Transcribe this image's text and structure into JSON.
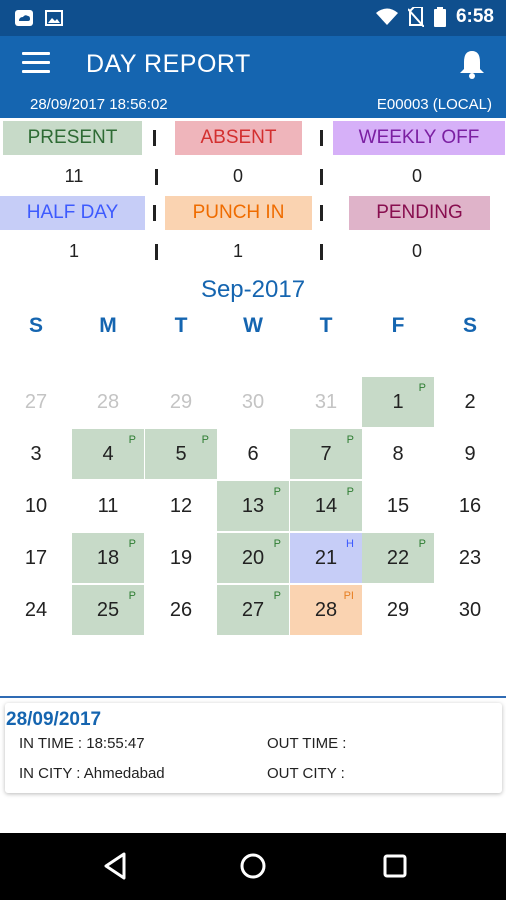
{
  "status_bar": {
    "time": "6:58",
    "icons": [
      "cloud-icon",
      "image-icon",
      "wifi-icon",
      "no-sim-icon",
      "battery-icon"
    ]
  },
  "app_bar": {
    "title": "DAY REPORT",
    "menu_icon": "menu-icon",
    "notification_icon": "bell-icon"
  },
  "sub_bar": {
    "datetime": "28/09/2017  18:56:02",
    "employee": "E00003  (LOCAL)"
  },
  "summary_row1": [
    {
      "label": "PRESENT",
      "count": "11",
      "bg": "#c7dac8",
      "fg": "#2e6b34"
    },
    {
      "label": "ABSENT",
      "count": "0",
      "bg": "#efb5bb",
      "fg": "#d32f2f"
    },
    {
      "label": "WEEKLY OFF",
      "count": "0",
      "bg": "#d6b0f8",
      "fg": "#7b1fa2"
    }
  ],
  "summary_row2": [
    {
      "label": "HALF DAY",
      "count": "1",
      "bg": "#c6cdf7",
      "fg": "#3d5afe"
    },
    {
      "label": "PUNCH IN",
      "count": "1",
      "bg": "#fad3b1",
      "fg": "#ef6c00"
    },
    {
      "label": "PENDING",
      "count": "0",
      "bg": "#dfb3c9",
      "fg": "#880e4f"
    }
  ],
  "calendar": {
    "month": "Sep-2017",
    "weekdays": [
      "S",
      "M",
      "T",
      "W",
      "T",
      "F",
      "S"
    ],
    "weeks": [
      [
        {
          "d": "27",
          "t": "other"
        },
        {
          "d": "28",
          "t": "other"
        },
        {
          "d": "29",
          "t": "other"
        },
        {
          "d": "30",
          "t": "other"
        },
        {
          "d": "31",
          "t": "other"
        },
        {
          "d": "1",
          "t": "present",
          "tag": "P"
        },
        {
          "d": "2",
          "t": ""
        }
      ],
      [
        {
          "d": "3",
          "t": ""
        },
        {
          "d": "4",
          "t": "present",
          "tag": "P"
        },
        {
          "d": "5",
          "t": "present",
          "tag": "P"
        },
        {
          "d": "6",
          "t": ""
        },
        {
          "d": "7",
          "t": "present",
          "tag": "P"
        },
        {
          "d": "8",
          "t": ""
        },
        {
          "d": "9",
          "t": ""
        }
      ],
      [
        {
          "d": "10",
          "t": ""
        },
        {
          "d": "11",
          "t": ""
        },
        {
          "d": "12",
          "t": ""
        },
        {
          "d": "13",
          "t": "present",
          "tag": "P"
        },
        {
          "d": "14",
          "t": "present",
          "tag": "P"
        },
        {
          "d": "15",
          "t": ""
        },
        {
          "d": "16",
          "t": ""
        }
      ],
      [
        {
          "d": "17",
          "t": ""
        },
        {
          "d": "18",
          "t": "present",
          "tag": "P"
        },
        {
          "d": "19",
          "t": ""
        },
        {
          "d": "20",
          "t": "present",
          "tag": "P"
        },
        {
          "d": "21",
          "t": "half",
          "tag": "H"
        },
        {
          "d": "22",
          "t": "present",
          "tag": "P"
        },
        {
          "d": "23",
          "t": ""
        }
      ],
      [
        {
          "d": "24",
          "t": ""
        },
        {
          "d": "25",
          "t": "present",
          "tag": "P"
        },
        {
          "d": "26",
          "t": ""
        },
        {
          "d": "27",
          "t": "present",
          "tag": "P"
        },
        {
          "d": "28",
          "t": "punch",
          "tag": "PI"
        },
        {
          "d": "29",
          "t": ""
        },
        {
          "d": "30",
          "t": ""
        }
      ]
    ]
  },
  "detail": {
    "date": "28/09/2017",
    "in_time": "IN TIME : 18:55:47",
    "out_time": "OUT TIME :",
    "in_city": "IN CITY : Ahmedabad",
    "out_city": "OUT CITY :"
  },
  "nav": {
    "back_icon": "back-icon",
    "home_icon": "home-icon",
    "recents_icon": "recents-icon"
  }
}
